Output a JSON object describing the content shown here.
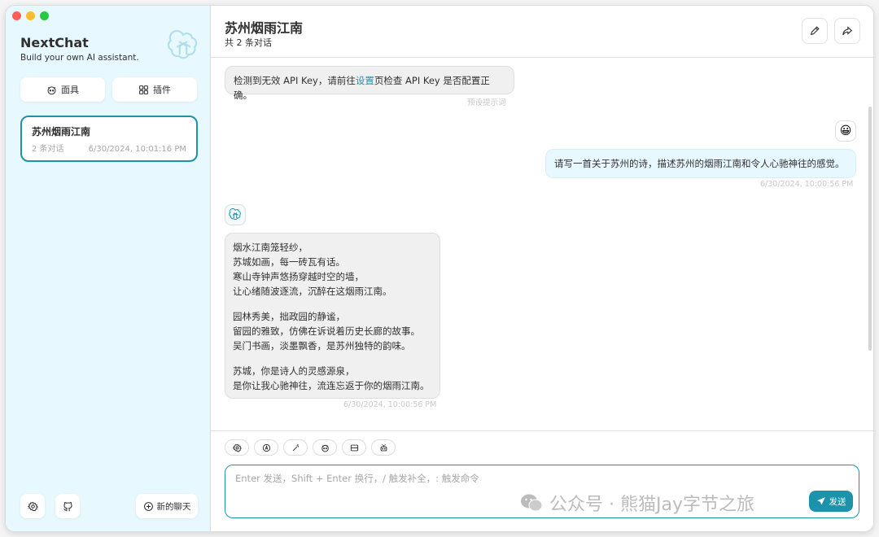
{
  "window": {
    "traffic_colors": [
      "#fe5f57",
      "#febc2e",
      "#28c840"
    ]
  },
  "sidebar": {
    "title": "NextChat",
    "subtitle": "Build your own AI assistant.",
    "mask_button": "面具",
    "plugin_button": "插件",
    "chats": [
      {
        "title": "苏州烟雨江南",
        "count": "2 条对话",
        "date": "6/30/2024, 10:01:16 PM"
      }
    ],
    "new_chat_label": "新的聊天"
  },
  "header": {
    "title": "苏州烟雨江南",
    "subtitle": "共 2 条对话"
  },
  "messages": {
    "system": {
      "text_before": "检测到无效 API Key，请前往",
      "link": "设置",
      "text_after": "页检查 API Key 是否配置正确。",
      "caption": "预设提示词"
    },
    "user": {
      "text": "请写一首关于苏州的诗，描述苏州的烟雨江南和令人心驰神往的感觉。",
      "time": "6/30/2024, 10:00:56 PM",
      "avatar_emoji": "😀"
    },
    "assistant": {
      "stanzas": [
        [
          "烟水江南笼轻纱，",
          "苏城如画，每一砖瓦有话。",
          "寒山寺钟声悠扬穿越时空的墙，",
          "让心绪随波逐流，沉醉在这烟雨江南。"
        ],
        [
          "园林秀美，拙政园的静谧，",
          "留园的雅致，仿佛在诉说着历史长廊的故事。",
          "吴门书画，淡墨飘香，是苏州独特的韵味。"
        ],
        [
          "苏城，你是诗人的灵感源泉，",
          "是你让我心驰神往，流连忘返于你的烟雨江南。"
        ]
      ],
      "time": "6/30/2024, 10:00:56 PM"
    }
  },
  "input": {
    "placeholder": "Enter 发送，Shift + Enter 换行，/ 触发补全，: 触发命令",
    "send_label": "发送"
  },
  "watermark": "公众号 · 熊猫Jay字节之旅",
  "colors": {
    "accent": "#1d93ab",
    "sidebar_bg": "#e7f8ff"
  }
}
